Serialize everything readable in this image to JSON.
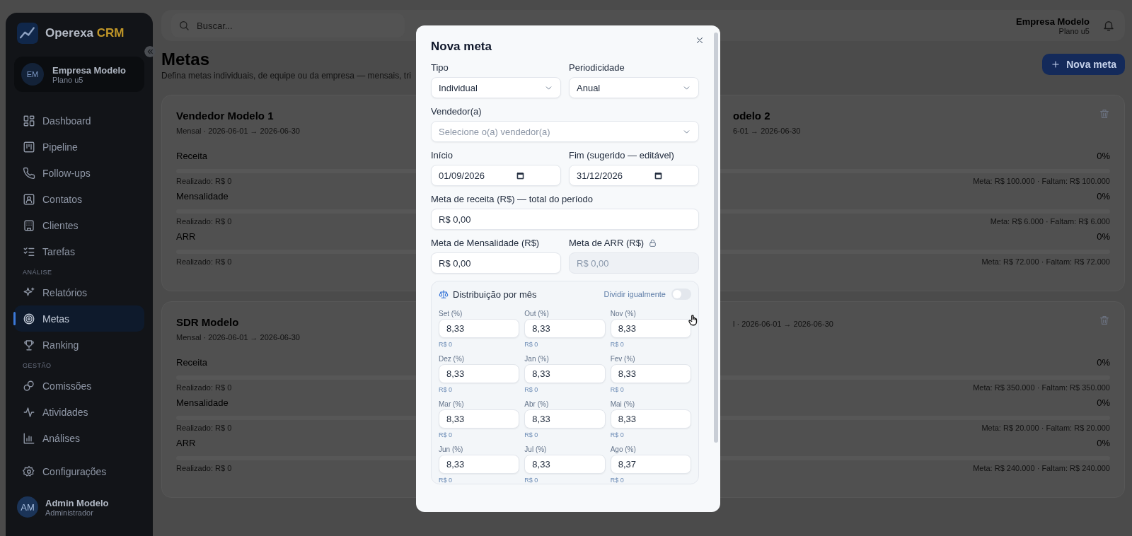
{
  "sidebar": {
    "brand": {
      "name": "Operexa",
      "accent": "CRM"
    },
    "company": {
      "initials": "EM",
      "name": "Empresa Modelo",
      "plan": "Plano u5"
    },
    "sections": [
      {
        "items": [
          {
            "label": "Dashboard",
            "kind": "dashboard",
            "selected": false
          },
          {
            "label": "Pipeline",
            "kind": "pipeline",
            "selected": false
          },
          {
            "label": "Follow-ups",
            "kind": "phone",
            "selected": false
          },
          {
            "label": "Contatos",
            "kind": "contact",
            "selected": false
          },
          {
            "label": "Clientes",
            "kind": "building",
            "selected": false
          },
          {
            "label": "Tarefas",
            "kind": "checklist",
            "selected": false
          }
        ]
      },
      {
        "heading": "ANÁLISE",
        "items": [
          {
            "label": "Relatórios",
            "kind": "sparkle",
            "selected": false
          },
          {
            "label": "Metas",
            "kind": "target",
            "selected": true
          },
          {
            "label": "Ranking",
            "kind": "trophy",
            "selected": false
          }
        ]
      },
      {
        "heading": "GESTÃO",
        "items": [
          {
            "label": "Comissões",
            "kind": "coins",
            "selected": false
          },
          {
            "label": "Atividades",
            "kind": "pulse",
            "selected": false
          },
          {
            "label": "Análises",
            "kind": "bars",
            "selected": false
          }
        ]
      },
      {
        "items": [
          {
            "label": "Configurações",
            "kind": "gear",
            "selected": false
          }
        ]
      }
    ],
    "user": {
      "initials": "AM",
      "name": "Admin Modelo",
      "role": "Administrador"
    }
  },
  "topbar": {
    "search": {
      "placeholder": "Buscar..."
    },
    "company": "Empresa Modelo",
    "plan": "Plano u5"
  },
  "page": {
    "title": "Metas",
    "subtitle": "Defina metas individuais, de equipe ou da empresa — mensais, tri",
    "new_button": "Nova meta"
  },
  "goal_cards": [
    {
      "title": "Vendedor Modelo 1",
      "period": "Mensal · 2026-06-01 → 2026-06-30",
      "metrics": [
        {
          "label": "Receita",
          "detail": "Realizado: R$ 0",
          "level": 0
        },
        {
          "label": "Mensalidade",
          "detail": "Realizado: R$ 0",
          "level": 0
        },
        {
          "label": "ARR",
          "detail": "Realizado: R$ 0",
          "level": 0
        }
      ]
    },
    {
      "title": "odelo 2",
      "period": "6-01 → 2026-06-30",
      "metrics": [
        {
          "percent": "0%",
          "detail": "Meta: R$ 100.000 · Faltam: R$ 100.000",
          "level": 0
        },
        {
          "percent": "0%",
          "detail": "Meta: R$ 6.000 · Faltam: R$ 6.000",
          "level": 0
        },
        {
          "percent": "0%",
          "detail": "Meta: R$ 72.000 · Faltam: R$ 72.000",
          "level": 0
        }
      ]
    },
    {
      "title": "SDR Modelo",
      "period": "Mensal · 2026-06-01 → 2026-06-30",
      "metrics": [
        {
          "label": "Receita",
          "detail": "Realizado: R$ 0",
          "level": 0
        },
        {
          "label": "Mensalidade",
          "detail": "Realizado: R$ 0",
          "level": 0
        },
        {
          "label": "ARR",
          "detail": "Realizado: R$ 0",
          "level": 0
        }
      ]
    },
    {
      "period": "l · 2026-06-01 → 2026-06-30",
      "metrics": [
        {
          "percent": "0%",
          "detail": "Meta: R$ 350.000 · Faltam: R$ 350.000",
          "level": 0
        },
        {
          "percent": "0%",
          "detail": "Meta: R$ 20.000 · Faltam: R$ 20.000",
          "level": 0
        },
        {
          "percent": "0%",
          "detail": "Meta: R$ 240.000 · Faltam: R$ 240.000",
          "level": 0
        }
      ]
    }
  ],
  "modal": {
    "title": "Nova meta",
    "rows": [
      [
        {
          "kind": "select",
          "label": "Tipo",
          "value": "Individual",
          "disabled": false
        },
        {
          "kind": "select",
          "label": "Periodicidade",
          "value": "Anual",
          "disabled": false
        }
      ],
      [
        {
          "kind": "select",
          "label": "Vendedor(a)",
          "placeholder": "Selecione o(a) vendedor(a)",
          "disabled": false
        }
      ],
      [
        {
          "kind": "date",
          "label": "Início",
          "value": "01/09/2026",
          "disabled": false
        },
        {
          "kind": "date",
          "label": "Fim (sugerido — editável)",
          "value": "31/12/2026",
          "disabled": false
        }
      ],
      [
        {
          "kind": "money",
          "label": "Meta de receita (R$) — total do período",
          "value": "R$ 0,00",
          "disabled": false
        }
      ],
      [
        {
          "kind": "money",
          "label": "Meta de Mensalidade (R$)",
          "value": "R$ 0,00",
          "disabled": false
        },
        {
          "kind": "money",
          "label": "Meta de ARR (R$)",
          "value": "R$ 0,00",
          "disabled": true
        }
      ]
    ],
    "distribution": {
      "title": "Distribuição por mês",
      "toggle": {
        "label": "Dividir igualmente",
        "on": false
      },
      "months": [
        {
          "label": "Set (%)",
          "value": "8,33",
          "amount": "R$ 0"
        },
        {
          "label": "Out (%)",
          "value": "8,33",
          "amount": "R$ 0"
        },
        {
          "label": "Nov (%)",
          "value": "8,33",
          "amount": "R$ 0"
        },
        {
          "label": "Dez (%)",
          "value": "8,33",
          "amount": "R$ 0"
        },
        {
          "label": "Jan (%)",
          "value": "8,33",
          "amount": "R$ 0"
        },
        {
          "label": "Fev (%)",
          "value": "8,33",
          "amount": "R$ 0"
        },
        {
          "label": "Mar (%)",
          "value": "8,33",
          "amount": "R$ 0"
        },
        {
          "label": "Abr (%)",
          "value": "8,33",
          "amount": "R$ 0"
        },
        {
          "label": "Mai (%)",
          "value": "8,33",
          "amount": "R$ 0"
        },
        {
          "label": "Jun (%)",
          "value": "8,33",
          "amount": "R$ 0"
        },
        {
          "label": "Jul (%)",
          "value": "8,33",
          "amount": "R$ 0"
        },
        {
          "label": "Ago (%)",
          "value": "8,37",
          "amount": "R$ 0"
        }
      ]
    }
  }
}
